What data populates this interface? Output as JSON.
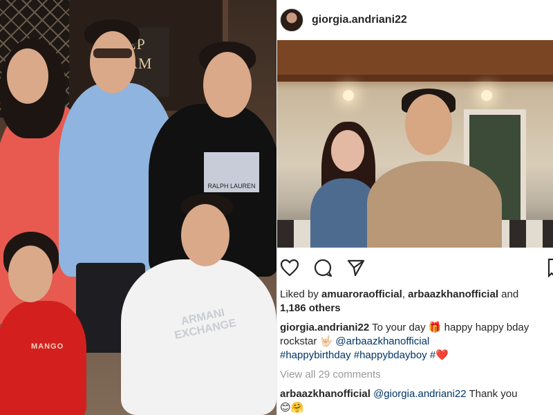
{
  "post": {
    "username": "giorgia.andriani22",
    "likes": {
      "prefix": "Liked by ",
      "user1": "amuaroraofficial",
      "separator": ", ",
      "user2": "arbaazkhanofficial",
      "suffix": " and",
      "others": "1,186 others"
    },
    "caption": {
      "author": "giorgia.andriani22",
      "text1": " To your day ",
      "emoji1": "🎁",
      "text2": " happy happy bday rockstar ",
      "emoji2": "🤟🏻",
      "mention": "@arbaazkhanofficial",
      "tag1": "#happybirthday",
      "tag2": "#happybdayboy",
      "tag3": "#",
      "emoji3": "❤️"
    },
    "view_all": "View all 29 comments",
    "comment": {
      "author": "arbaazkhanofficial",
      "mention": "@giorgia.andriani22",
      "text": " Thank you",
      "emojis": "😊🤗"
    }
  },
  "left_photo": {
    "sign_text": "EP\nAM",
    "shirt_brand": "MANGO",
    "shirt_print": "ARMANI\nEXCHANGE",
    "tee_print": "RALPH LAUREN"
  },
  "icons": {
    "like": "heart-icon",
    "comment": "comment-icon",
    "share": "share-icon",
    "save": "bookmark-icon"
  },
  "colors": {
    "link": "#003569",
    "muted": "#999999",
    "text": "#262626",
    "heart": "#ed4956"
  }
}
